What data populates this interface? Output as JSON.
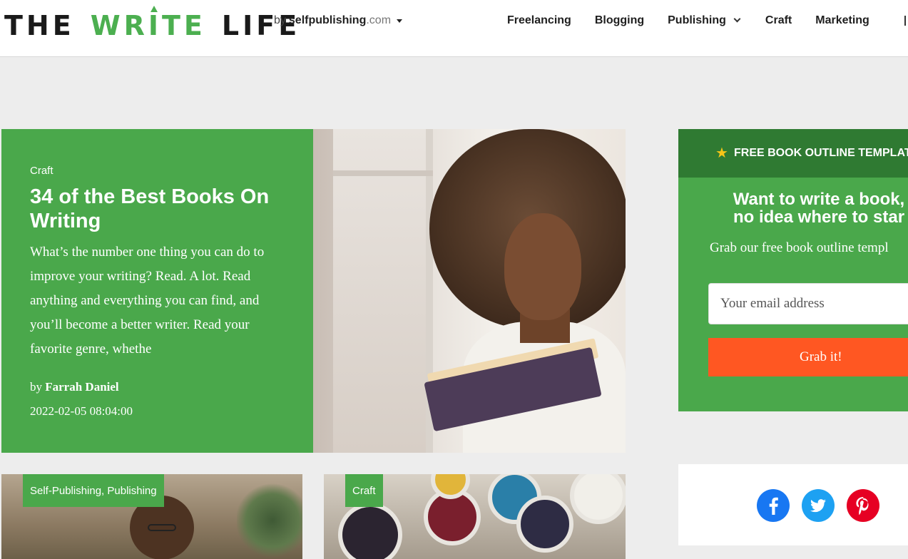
{
  "header": {
    "logo": {
      "word1": "THE",
      "word2": "WRITE",
      "word3": "LIFE"
    },
    "byline": {
      "prefix": "by",
      "site": "selfpublishing",
      "tld": ".com"
    },
    "nav": [
      {
        "label": "Freelancing"
      },
      {
        "label": "Blogging"
      },
      {
        "label": "Publishing"
      },
      {
        "label": "Craft"
      },
      {
        "label": "Marketing"
      }
    ]
  },
  "featured": {
    "category": "Craft",
    "title": "34 of the Best Books On Writing",
    "excerpt": "What’s the number one thing you can do to improve your writing? Read. A lot. Read anything and everything you can find, and you’ll become a better writer. Read your favorite genre, whethe",
    "by_prefix": "by",
    "author": "Farrah Daniel",
    "date": "2022-02-05 08:04:00"
  },
  "optin": {
    "badge": "FREE BOOK OUTLINE TEMPLATE",
    "title_line1": "Want to write a book,",
    "title_line2": "no idea where to star",
    "subtitle": "Grab our free book outline templ",
    "email_placeholder": "Your email address",
    "button": "Grab it!",
    "colors": {
      "panel": "#4aa84b",
      "header": "#2f7a32",
      "button": "#ff5722"
    }
  },
  "social": [
    {
      "icon": "facebook-icon"
    },
    {
      "icon": "twitter-icon"
    },
    {
      "icon": "pinterest-icon"
    }
  ],
  "cards": [
    {
      "tag": "Self-Publishing, Publishing"
    },
    {
      "tag": "Craft"
    }
  ]
}
